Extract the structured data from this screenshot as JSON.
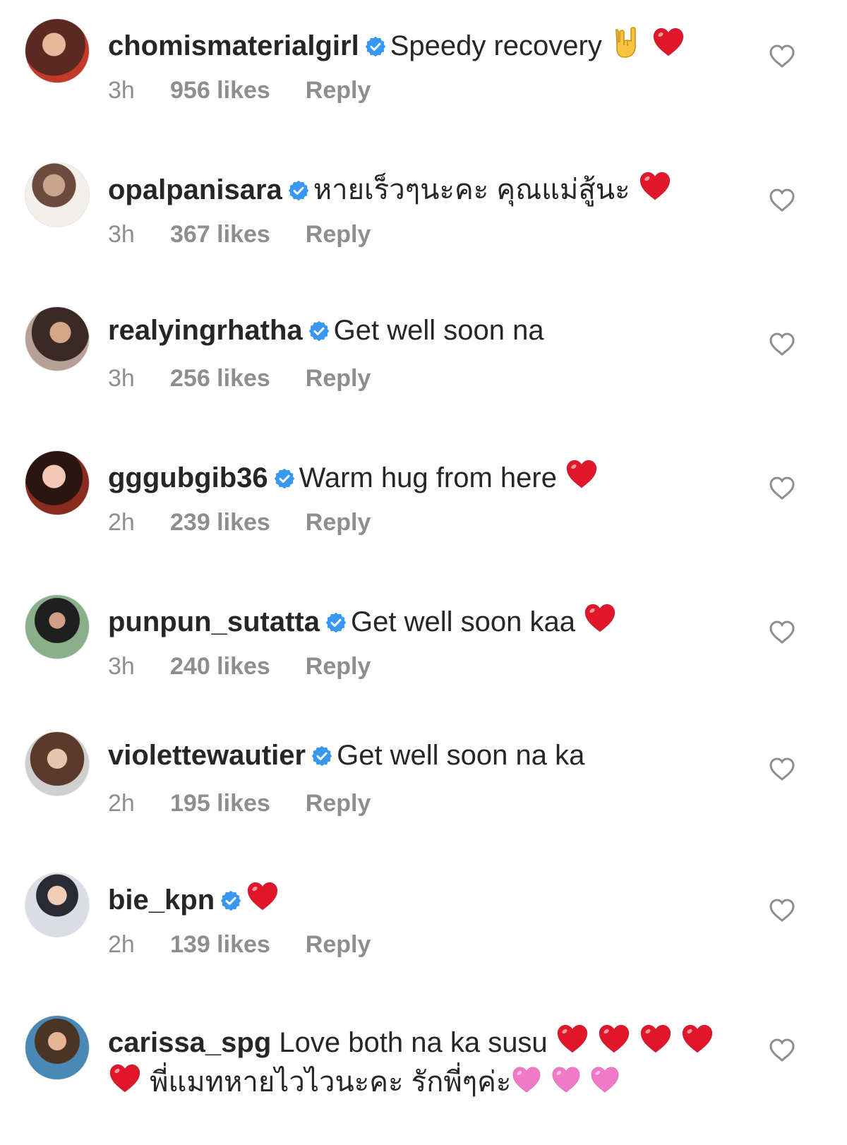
{
  "colors": {
    "verified": "#3897f0",
    "heart_red": "#e0162b",
    "heart_pink": "#f07ac8",
    "muted": "#8e8e8e"
  },
  "comments": [
    {
      "username": "chomismaterialgirl",
      "text": "Speedy recovery",
      "emojis": [
        "rock-hand",
        "red-heart"
      ],
      "time": "3h",
      "likes": "956 likes",
      "reply": "Reply"
    },
    {
      "username": "opalpanisara",
      "text": "หายเร็วๆนะคะ คุณแม่สู้นะ",
      "emojis": [
        "red-heart"
      ],
      "time": "3h",
      "likes": "367 likes",
      "reply": "Reply"
    },
    {
      "username": "realyingrhatha",
      "text": "Get well soon na",
      "emojis": [],
      "time": "3h",
      "likes": "256 likes",
      "reply": "Reply"
    },
    {
      "username": "gggubgib36",
      "text": "Warm hug from here",
      "emojis": [
        "red-heart"
      ],
      "time": "2h",
      "likes": "239 likes",
      "reply": "Reply"
    },
    {
      "username": "punpun_sutatta",
      "text": "Get well soon kaa",
      "emojis": [
        "red-heart"
      ],
      "time": "3h",
      "likes": "240 likes",
      "reply": "Reply"
    },
    {
      "username": "violettewautier",
      "text": "Get well soon na ka",
      "emojis": [],
      "time": "2h",
      "likes": "195 likes",
      "reply": "Reply"
    },
    {
      "username": "bie_kpn",
      "text": "",
      "emojis": [
        "red-heart"
      ],
      "time": "2h",
      "likes": "139 likes",
      "reply": "Reply"
    },
    {
      "username": "carissa_spg",
      "text": "Love both na ka susu",
      "text2": "พี่แมทหายไวไวนะคะ รักพี่ๆค่ะ",
      "emojis": [
        "red-heart",
        "red-heart",
        "red-heart",
        "red-heart"
      ],
      "emojis_line2_pre": [
        "red-heart"
      ],
      "emojis_line2_post": [
        "pink-heart",
        "pink-heart",
        "pink-heart"
      ]
    }
  ]
}
